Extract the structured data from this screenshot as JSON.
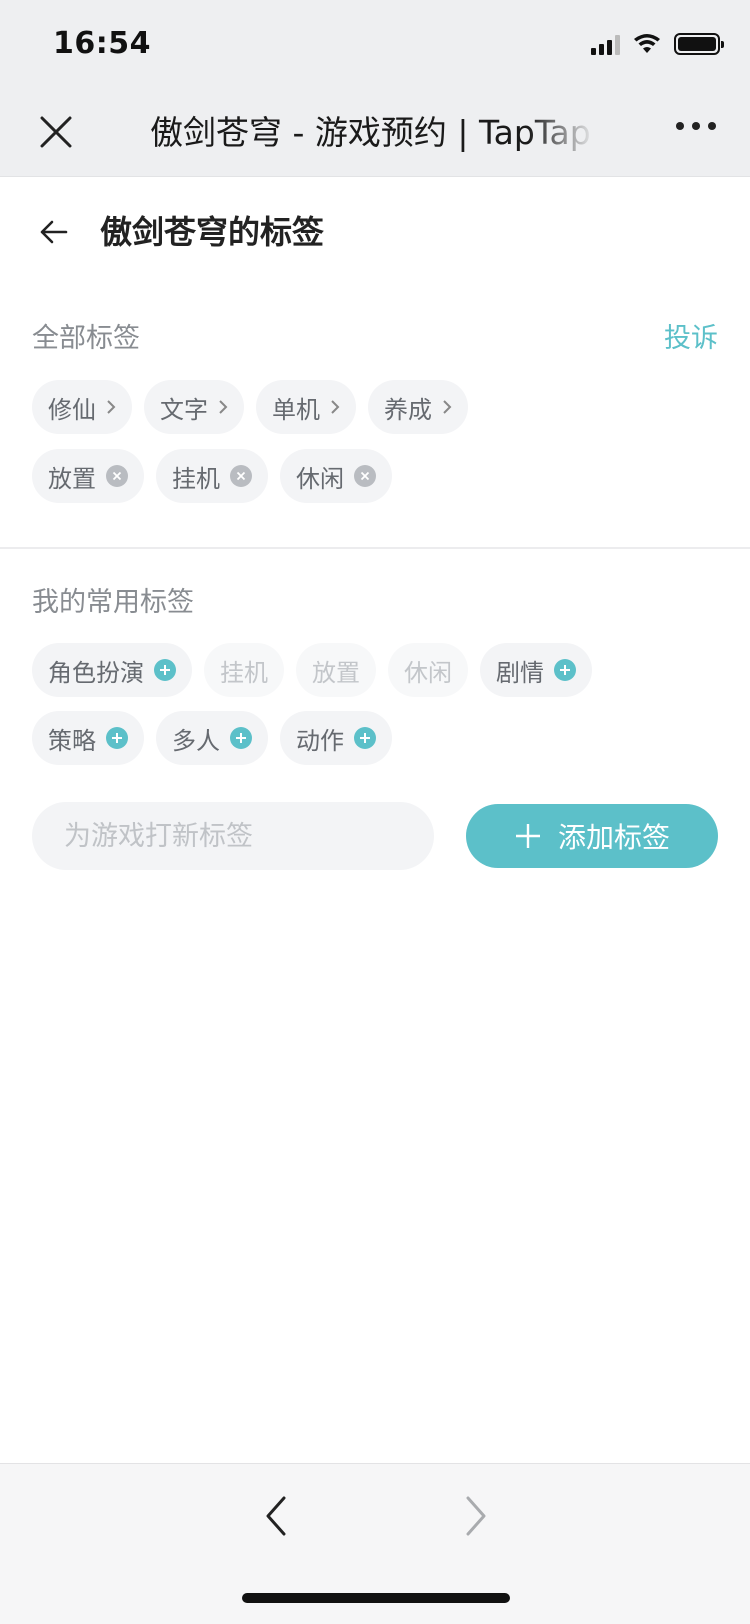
{
  "status_bar": {
    "time": "16:54"
  },
  "browser": {
    "title": "傲剑苍穹 - 游戏预约 | TapTap"
  },
  "page": {
    "title": "傲剑苍穹的标签",
    "all_tags_label": "全部标签",
    "report_label": "投诉",
    "all_tags_row1": [
      {
        "label": "修仙"
      },
      {
        "label": "文字"
      },
      {
        "label": "单机"
      },
      {
        "label": "养成"
      }
    ],
    "all_tags_row2": [
      {
        "label": "放置"
      },
      {
        "label": "挂机"
      },
      {
        "label": "休闲"
      }
    ],
    "common_tags_label": "我的常用标签",
    "common_tags_row1": [
      {
        "label": "角色扮演",
        "state": "addable"
      },
      {
        "label": "挂机",
        "state": "disabled"
      },
      {
        "label": "放置",
        "state": "disabled"
      },
      {
        "label": "休闲",
        "state": "disabled"
      },
      {
        "label": "剧情",
        "state": "addable"
      }
    ],
    "common_tags_row2": [
      {
        "label": "策略",
        "state": "addable"
      },
      {
        "label": "多人",
        "state": "addable"
      },
      {
        "label": "动作",
        "state": "addable"
      }
    ],
    "new_tag_placeholder": "为游戏打新标签",
    "add_button_label": "添加标签"
  },
  "colors": {
    "accent": "#5cc0c9",
    "tag_bg": "#f3f4f6",
    "muted_text": "#888c91"
  }
}
